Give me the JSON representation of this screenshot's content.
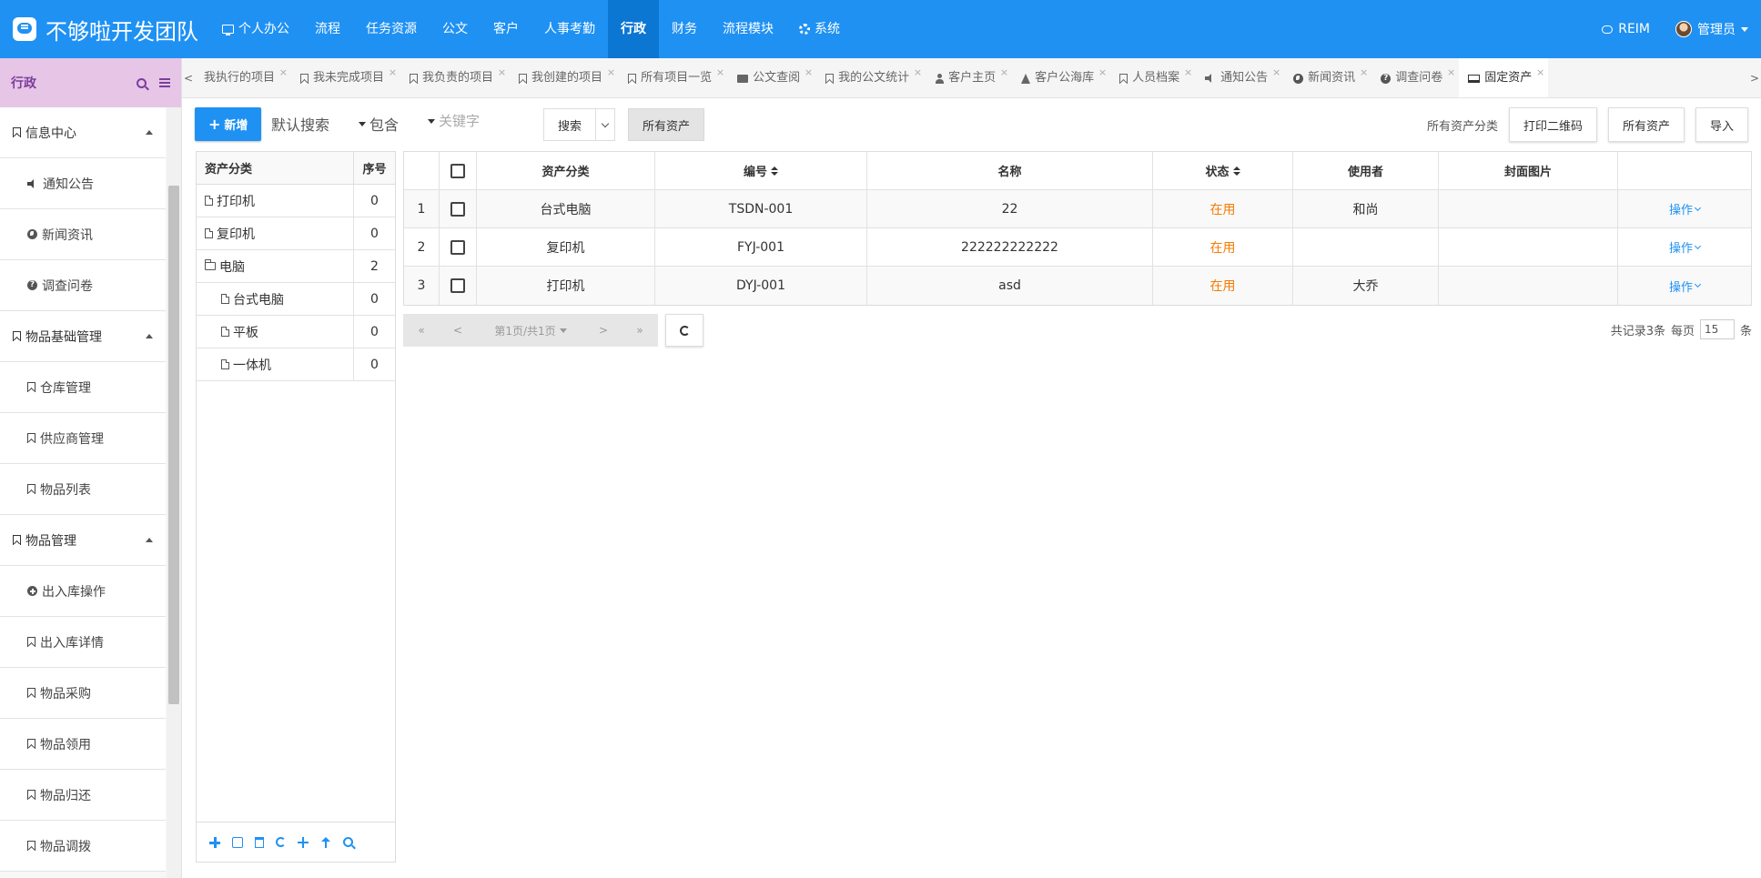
{
  "brand": {
    "name": "不够啦开发团队"
  },
  "nav": [
    {
      "label": "个人办公",
      "icon": "monitor-icon"
    },
    {
      "label": "流程"
    },
    {
      "label": "任务资源"
    },
    {
      "label": "公文"
    },
    {
      "label": "客户"
    },
    {
      "label": "人事考勤"
    },
    {
      "label": "行政",
      "active": true
    },
    {
      "label": "财务"
    },
    {
      "label": "流程模块"
    },
    {
      "label": "系统",
      "icon": "gear-icon"
    }
  ],
  "top_right": {
    "reim": "REIM",
    "user": "管理员"
  },
  "sidebar": {
    "title": "行政",
    "items": [
      {
        "type": "group",
        "label": "信息中心"
      },
      {
        "type": "sub",
        "label": "通知公告",
        "icon": "speaker-icon"
      },
      {
        "type": "sub",
        "label": "新闻资讯",
        "icon": "globe-icon"
      },
      {
        "type": "sub",
        "label": "调查问卷",
        "icon": "question-icon"
      },
      {
        "type": "group",
        "label": "物品基础管理"
      },
      {
        "type": "sub",
        "label": "仓库管理",
        "icon": "bookmark-icon"
      },
      {
        "type": "sub",
        "label": "供应商管理",
        "icon": "bookmark-icon"
      },
      {
        "type": "sub",
        "label": "物品列表",
        "icon": "bookmark-icon"
      },
      {
        "type": "group",
        "label": "物品管理"
      },
      {
        "type": "sub",
        "label": "出入库操作",
        "icon": "plus-circle-icon"
      },
      {
        "type": "sub",
        "label": "出入库详情",
        "icon": "bookmark-icon"
      },
      {
        "type": "sub",
        "label": "物品采购",
        "icon": "bookmark-icon"
      },
      {
        "type": "sub",
        "label": "物品领用",
        "icon": "bookmark-icon"
      },
      {
        "type": "sub",
        "label": "物品归还",
        "icon": "bookmark-icon"
      },
      {
        "type": "sub",
        "label": "物品调拨",
        "icon": "bookmark-icon"
      }
    ]
  },
  "tabs": [
    {
      "label": "我执行的项目",
      "icon": ""
    },
    {
      "label": "我未完成项目",
      "icon": "bookmark-icon"
    },
    {
      "label": "我负责的项目",
      "icon": "bookmark-icon"
    },
    {
      "label": "我创建的项目",
      "icon": "bookmark-icon"
    },
    {
      "label": "所有项目一览",
      "icon": "bookmark-icon"
    },
    {
      "label": "公文查阅",
      "icon": "briefcase-icon"
    },
    {
      "label": "我的公文统计",
      "icon": "bookmark-icon"
    },
    {
      "label": "客户主页",
      "icon": "user-icon"
    },
    {
      "label": "客户公海库",
      "icon": "flask-icon"
    },
    {
      "label": "人员档案",
      "icon": "bookmark-icon"
    },
    {
      "label": "通知公告",
      "icon": "speaker-icon"
    },
    {
      "label": "新闻资讯",
      "icon": "globe-icon"
    },
    {
      "label": "调查问卷",
      "icon": "question-icon"
    },
    {
      "label": "固定资产",
      "icon": "laptop-icon",
      "active": true
    }
  ],
  "toolbar": {
    "new_label": "新增",
    "search_mode": "默认搜索",
    "search_op": "包含",
    "keyword_placeholder": "关键字",
    "search_label": "搜索",
    "all_assets_filter": "所有资产",
    "category_label": "所有资产分类",
    "print_qr": "打印二维码",
    "all_assets": "所有资产",
    "import": "导入"
  },
  "tree": {
    "headers": {
      "name": "资产分类",
      "order": "序号"
    },
    "rows": [
      {
        "name": "打印机",
        "order": "0",
        "level": 0,
        "type": "file"
      },
      {
        "name": "复印机",
        "order": "0",
        "level": 0,
        "type": "file"
      },
      {
        "name": "电脑",
        "order": "2",
        "level": 0,
        "type": "folder"
      },
      {
        "name": "台式电脑",
        "order": "0",
        "level": 1,
        "type": "file"
      },
      {
        "name": "平板",
        "order": "0",
        "level": 1,
        "type": "file"
      },
      {
        "name": "一体机",
        "order": "0",
        "level": 1,
        "type": "file"
      }
    ]
  },
  "grid": {
    "headers": {
      "category": "资产分类",
      "number": "编号",
      "name": "名称",
      "status": "状态",
      "user": "使用者",
      "cover": "封面图片"
    },
    "rows": [
      {
        "idx": "1",
        "category": "台式电脑",
        "number": "TSDN-001",
        "name": "22",
        "status": "在用",
        "user": "和尚",
        "cover": "",
        "op": "操作"
      },
      {
        "idx": "2",
        "category": "复印机",
        "number": "FYJ-001",
        "name": "222222222222",
        "status": "在用",
        "user": "",
        "cover": "",
        "op": "操作"
      },
      {
        "idx": "3",
        "category": "打印机",
        "number": "DYJ-001",
        "name": "asd",
        "status": "在用",
        "user": "大乔",
        "cover": "",
        "op": "操作"
      }
    ]
  },
  "pager": {
    "first": "«",
    "prev": "<",
    "info": "第1页/共1页",
    "next": ">",
    "last": "»",
    "total": "共记录3条",
    "per_page_label": "每页",
    "per_page_value": "15",
    "unit": "条"
  },
  "colors": {
    "primary": "#1f91f3",
    "nav_active": "#0c76d3",
    "sidebar_head": "#e7c5e6",
    "status": "#f57c00"
  }
}
